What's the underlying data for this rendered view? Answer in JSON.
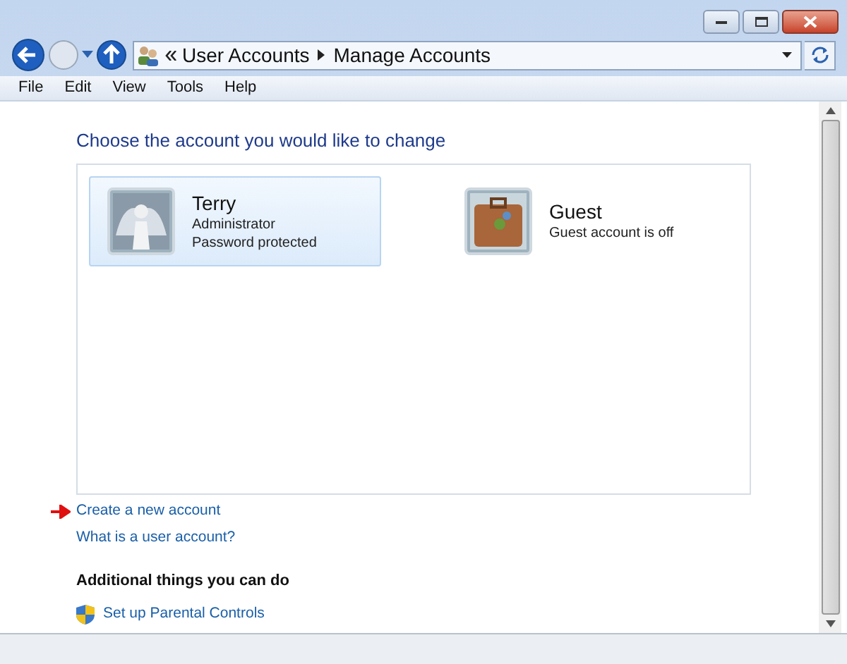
{
  "address_bar": {
    "breadcrumbs": [
      "User Accounts",
      "Manage Accounts"
    ]
  },
  "menu_bar": [
    "File",
    "Edit",
    "View",
    "Tools",
    "Help"
  ],
  "heading": "Choose the account you would like to change",
  "accounts": [
    {
      "name": "Terry",
      "details": [
        "Administrator",
        "Password protected"
      ],
      "selected": true,
      "kind": "angel"
    },
    {
      "name": "Guest",
      "details": [
        "Guest account is off"
      ],
      "selected": false,
      "kind": "suitcase"
    }
  ],
  "links": [
    {
      "label": "Create a new account",
      "pointed": true
    },
    {
      "label": "What is a user account?",
      "pointed": false
    }
  ],
  "additional": {
    "title": "Additional things you can do",
    "tasks": [
      {
        "label": "Set up Parental Controls"
      }
    ]
  }
}
